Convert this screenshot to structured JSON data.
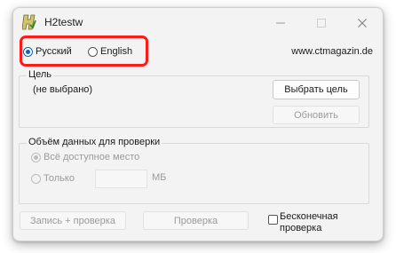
{
  "window": {
    "title": "H2testw",
    "icon": "h2testw-app-icon",
    "minimize_icon": "minimize-icon",
    "maximize_icon": "maximize-icon",
    "close_icon": "close-icon"
  },
  "language": {
    "options": [
      {
        "label": "Русский",
        "selected": true
      },
      {
        "label": "English",
        "selected": false
      }
    ],
    "highlight_color": "#ff1a1a"
  },
  "website": "www.ctmagazin.de",
  "target": {
    "group_label": "Цель",
    "status": "(не выбрано)",
    "select_button": "Выбрать цель",
    "refresh_button": "Обновить"
  },
  "data_volume": {
    "group_label": "Объём данных для проверки",
    "all_space_label": "Всё доступное место",
    "only_label": "Только",
    "only_value": "",
    "unit": "МБ"
  },
  "actions": {
    "write_verify_button": "Запись + проверка",
    "verify_button": "Проверка",
    "endless_label_line1": "Бесконечная",
    "endless_label_line2": "проверка",
    "endless_checked": false
  },
  "colors": {
    "accent": "#0a64b8",
    "disabled_text": "#9b9b9b",
    "window_bg": "#f3f3f3"
  }
}
